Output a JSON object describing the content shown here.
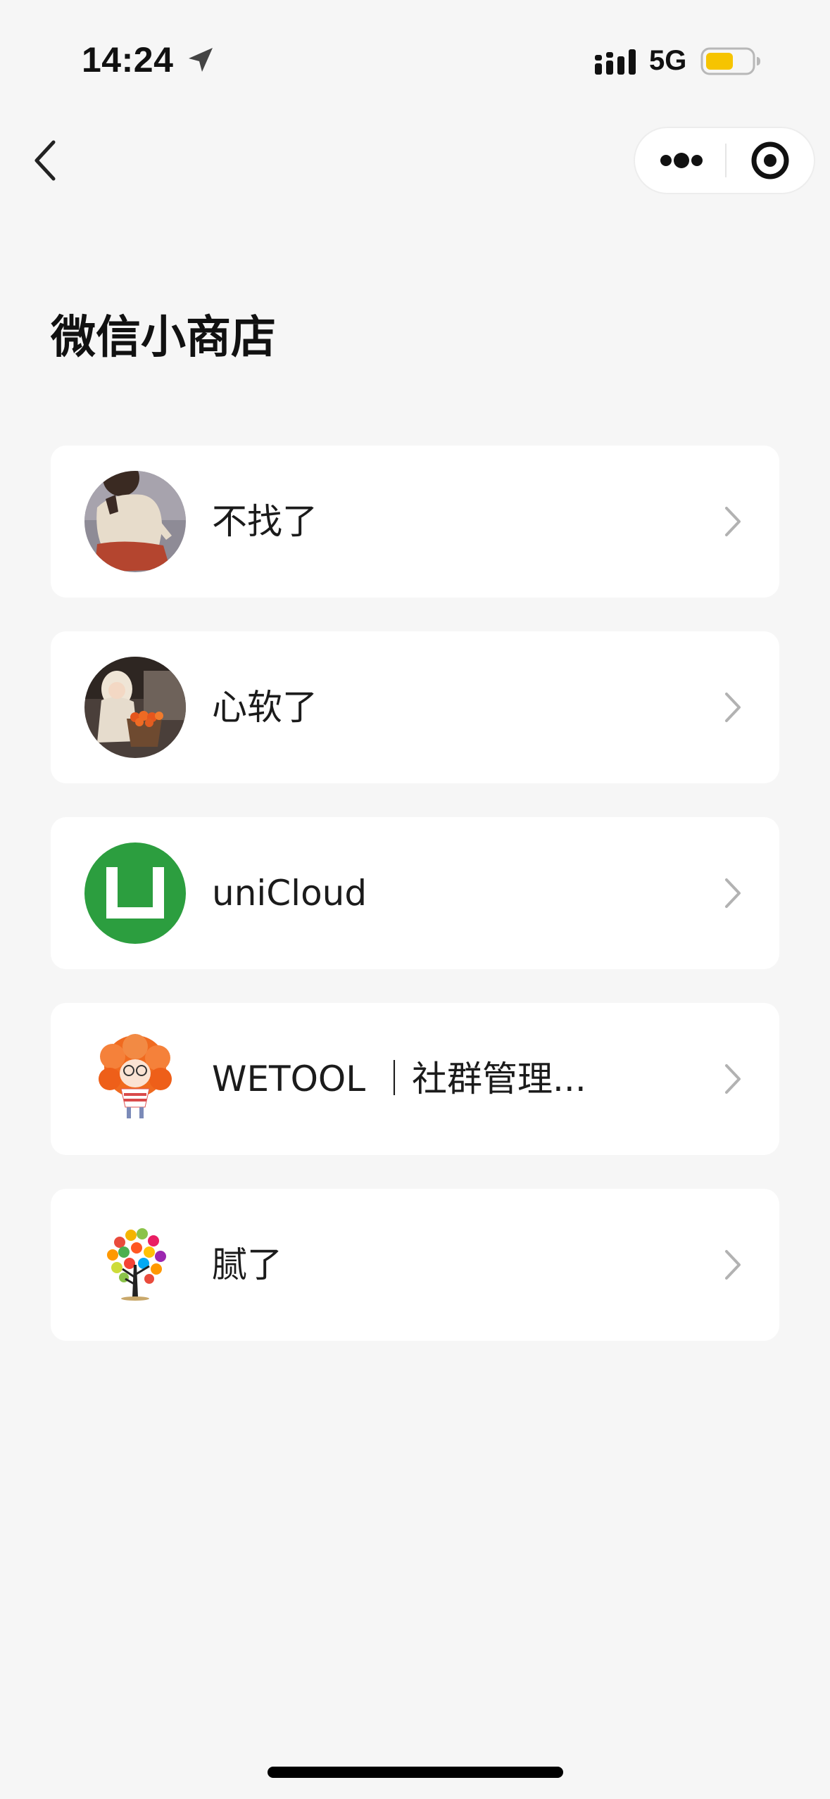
{
  "status_bar": {
    "time": "14:24",
    "network": "5G",
    "battery_color": "#f6c400",
    "icons": [
      "location-arrow-icon",
      "cellular-signal-icon",
      "battery-icon"
    ]
  },
  "nav": {
    "back_icon": "chevron-left-icon",
    "more_icon": "more-dots-icon",
    "close_icon": "target-circle-icon"
  },
  "page": {
    "title": "微信小商店"
  },
  "stores": [
    {
      "name": "不找了",
      "avatar": "illustrated-figure-avatar"
    },
    {
      "name": "心软了",
      "avatar": "photo-girl-with-basket-avatar"
    },
    {
      "name": "uniCloud",
      "avatar": "unicloud-logo-avatar",
      "brand_color": "#2c9e3f"
    },
    {
      "name": "WETOOL ｜社群管理...",
      "avatar": "orange-hair-character-avatar"
    },
    {
      "name": "腻了",
      "avatar": "colorful-tree-avatar"
    }
  ],
  "colors": {
    "page_background": "#f6f6f6",
    "card_background": "#ffffff",
    "chevron": "#b2b2b2"
  }
}
